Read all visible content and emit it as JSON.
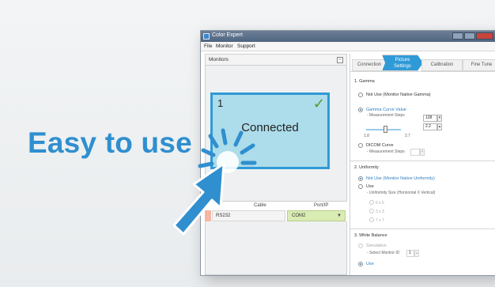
{
  "headline": "Easy to use",
  "window": {
    "title": "Color Expert",
    "menu": [
      "File",
      "Monitor",
      "Support"
    ]
  },
  "monitors_panel": {
    "title": "Monitors",
    "monitor": {
      "number": "1",
      "status": "Connected"
    },
    "table": {
      "cable_header": "Cable",
      "port_header": "Port/IP",
      "cable_value": "RS232",
      "port_value": "COM2"
    }
  },
  "settings": {
    "tabs": [
      {
        "label": "Connection"
      },
      {
        "label_line1": "Picture",
        "label_line2": "Settings"
      },
      {
        "label": "Calibration"
      },
      {
        "label": "Fine Tune"
      }
    ],
    "gamma": {
      "title": "1. Gamma",
      "opt_native": "Not Use (Monitor Native Gamma)",
      "opt_curve": "Gamma Curve Value",
      "curve_steps_label": "- Measurement Steps",
      "curve_steps_value": "128",
      "curve_value": "2.2",
      "slider_min": "1.8",
      "slider_max": "2.7",
      "opt_dicom": "DICOM Curve",
      "dicom_steps_label": "- Measurement Steps"
    },
    "uniformity": {
      "title": "2. Uniformity",
      "opt_not_use": "Not Use (Monitor Native Uniformity)",
      "opt_use": "Use",
      "size_label": "- Uniformity Size (Horizontal X Vertical)",
      "sizes": [
        "5 x 5",
        "3 x 3",
        "7 x 7"
      ]
    },
    "white_balance": {
      "title": "3. White Balance",
      "opt_simulation": "Simulation",
      "select_monitor_label": "- Select Monitor ID",
      "select_monitor_value": "1",
      "opt_use": "Use"
    }
  }
}
